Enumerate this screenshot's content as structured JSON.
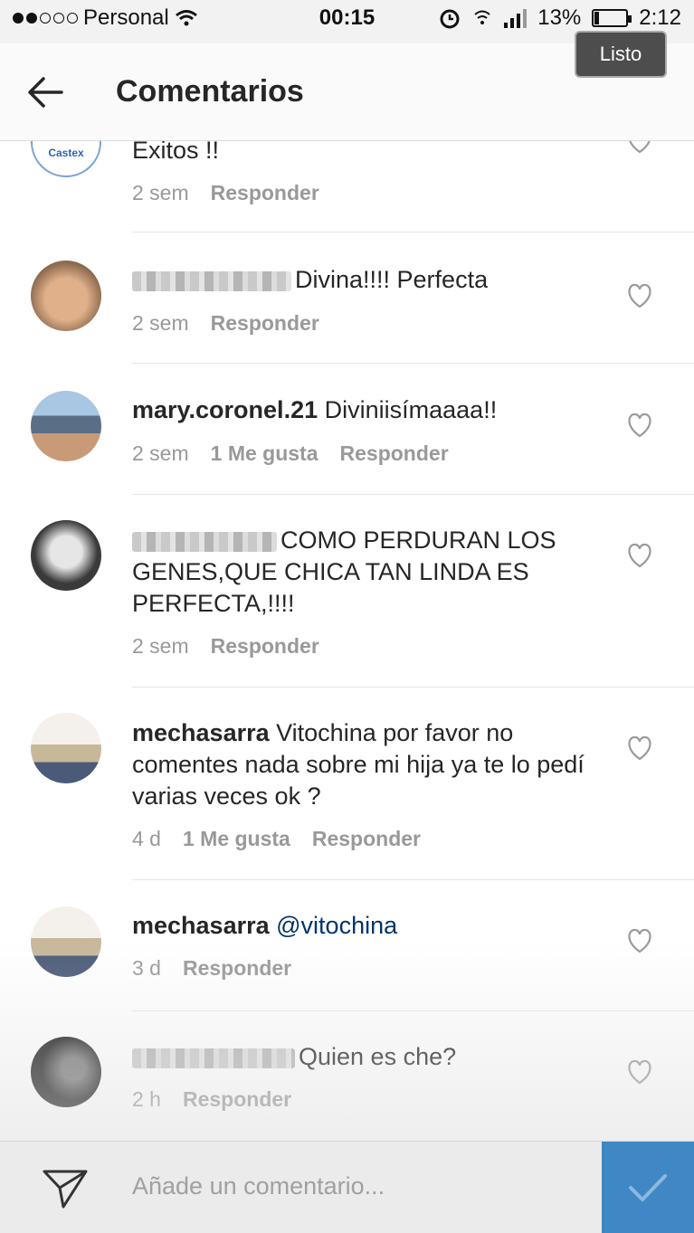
{
  "status_bar": {
    "carrier": "Personal",
    "time": "00:15",
    "battery_percent": "13%",
    "battery_level": 0.13,
    "clock_right": "2:12"
  },
  "overlay": {
    "done_label": "Listo"
  },
  "header": {
    "title": "Comentarios"
  },
  "comments": [
    {
      "username": "",
      "text": "Exitos !!",
      "time": "2 sem",
      "likes": "",
      "reply": "Responder"
    },
    {
      "username": "",
      "text": "Divina!!!! Perfecta",
      "time": "2 sem",
      "likes": "",
      "reply": "Responder"
    },
    {
      "username": "mary.coronel.21",
      "text": "Diviniisímaaaa!!",
      "time": "2 sem",
      "likes": "1 Me gusta",
      "reply": "Responder"
    },
    {
      "username": "",
      "text": "COMO PERDURAN LOS GENES,QUE CHICA TAN LINDA ES PERFECTA,!!!!",
      "time": "2 sem",
      "likes": "",
      "reply": "Responder"
    },
    {
      "username": "mechasarra",
      "text": "Vitochina por favor no comentes nada sobre mi hija ya te lo pedí varias veces ok ?",
      "time": "4 d",
      "likes": "1 Me gusta",
      "reply": "Responder"
    },
    {
      "username": "mechasarra",
      "text": "@vitochina",
      "time": "3 d",
      "likes": "",
      "reply": "Responder"
    },
    {
      "username": "",
      "text": "Quien es che?",
      "time": "2 h",
      "likes": "",
      "reply": "Responder"
    }
  ],
  "avatar_badge": "Castex",
  "composer": {
    "placeholder": "Añade un comentario..."
  },
  "colors": {
    "accent": "#3f88c5",
    "mention": "#003569",
    "meta": "#999999"
  }
}
